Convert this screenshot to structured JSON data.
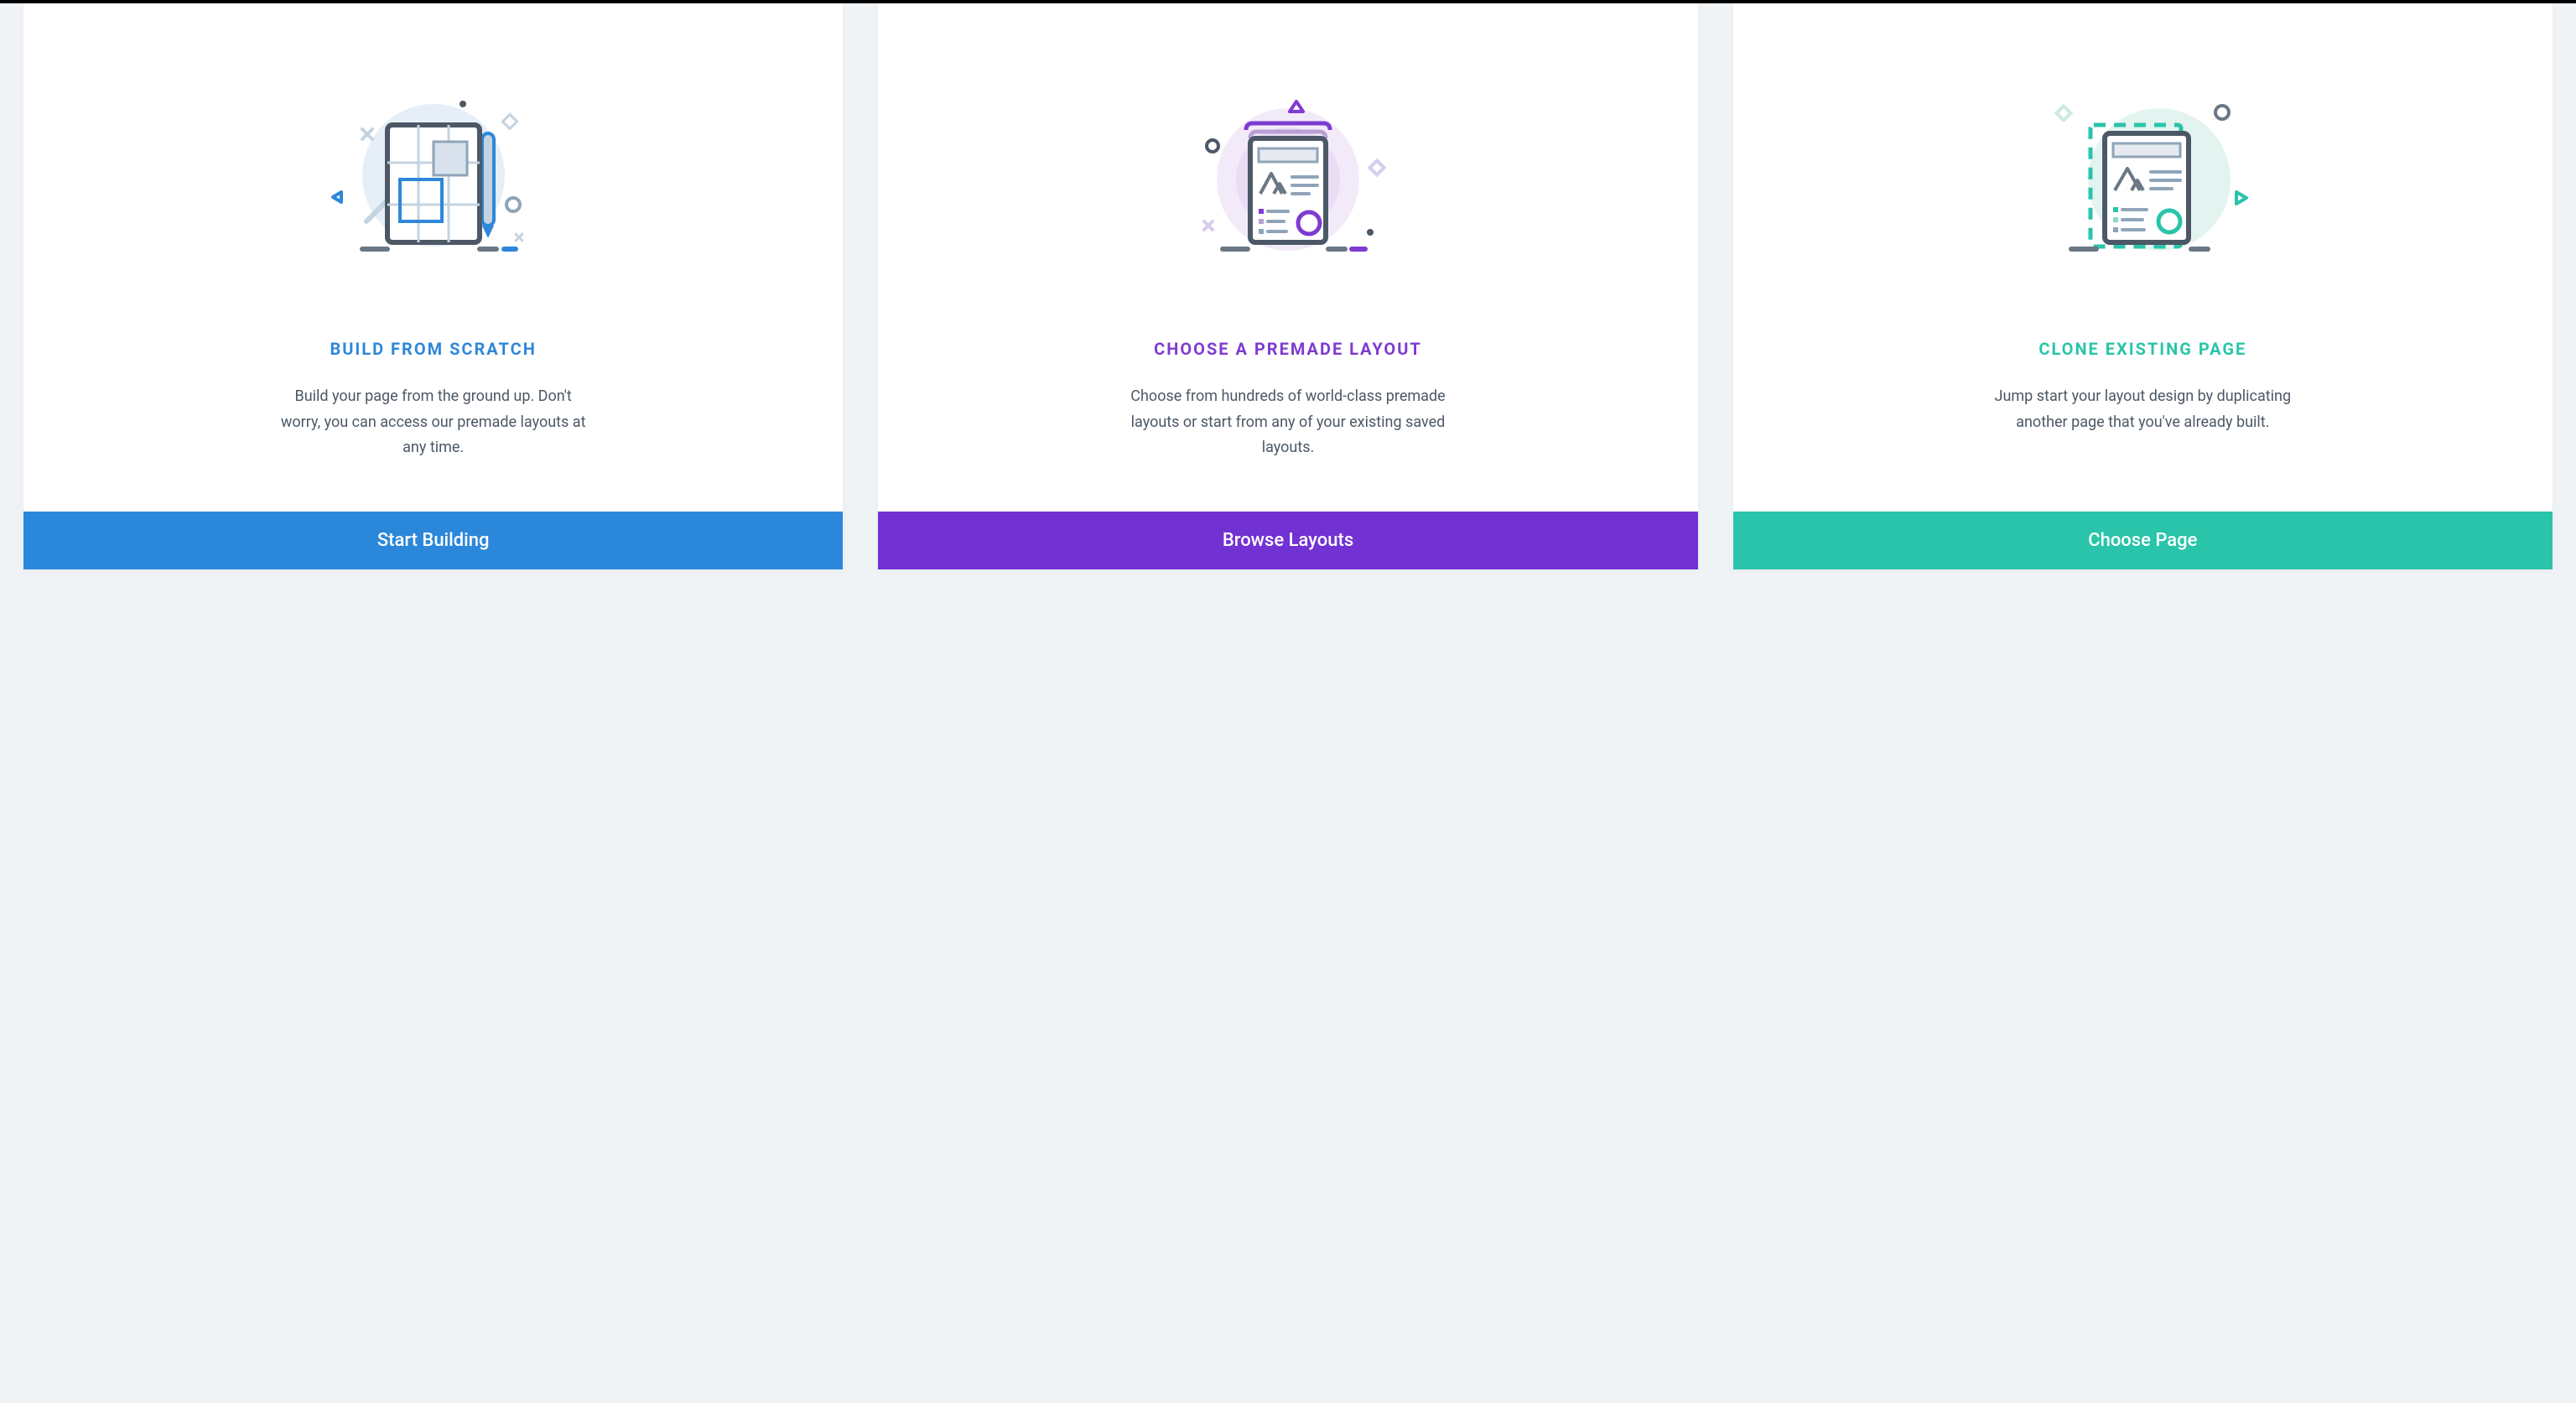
{
  "cards": [
    {
      "title": "BUILD FROM SCRATCH",
      "description": "Build your page from the ground up. Don't worry, you can access our premade layouts at any time.",
      "button": "Start Building",
      "color": "blue"
    },
    {
      "title": "CHOOSE A PREMADE LAYOUT",
      "description": "Choose from hundreds of world-class premade layouts or start from any of your existing saved layouts.",
      "button": "Browse Layouts",
      "color": "purple"
    },
    {
      "title": "CLONE EXISTING PAGE",
      "description": "Jump start your layout design by duplicating another page that you've already built.",
      "button": "Choose Page",
      "color": "teal"
    }
  ]
}
